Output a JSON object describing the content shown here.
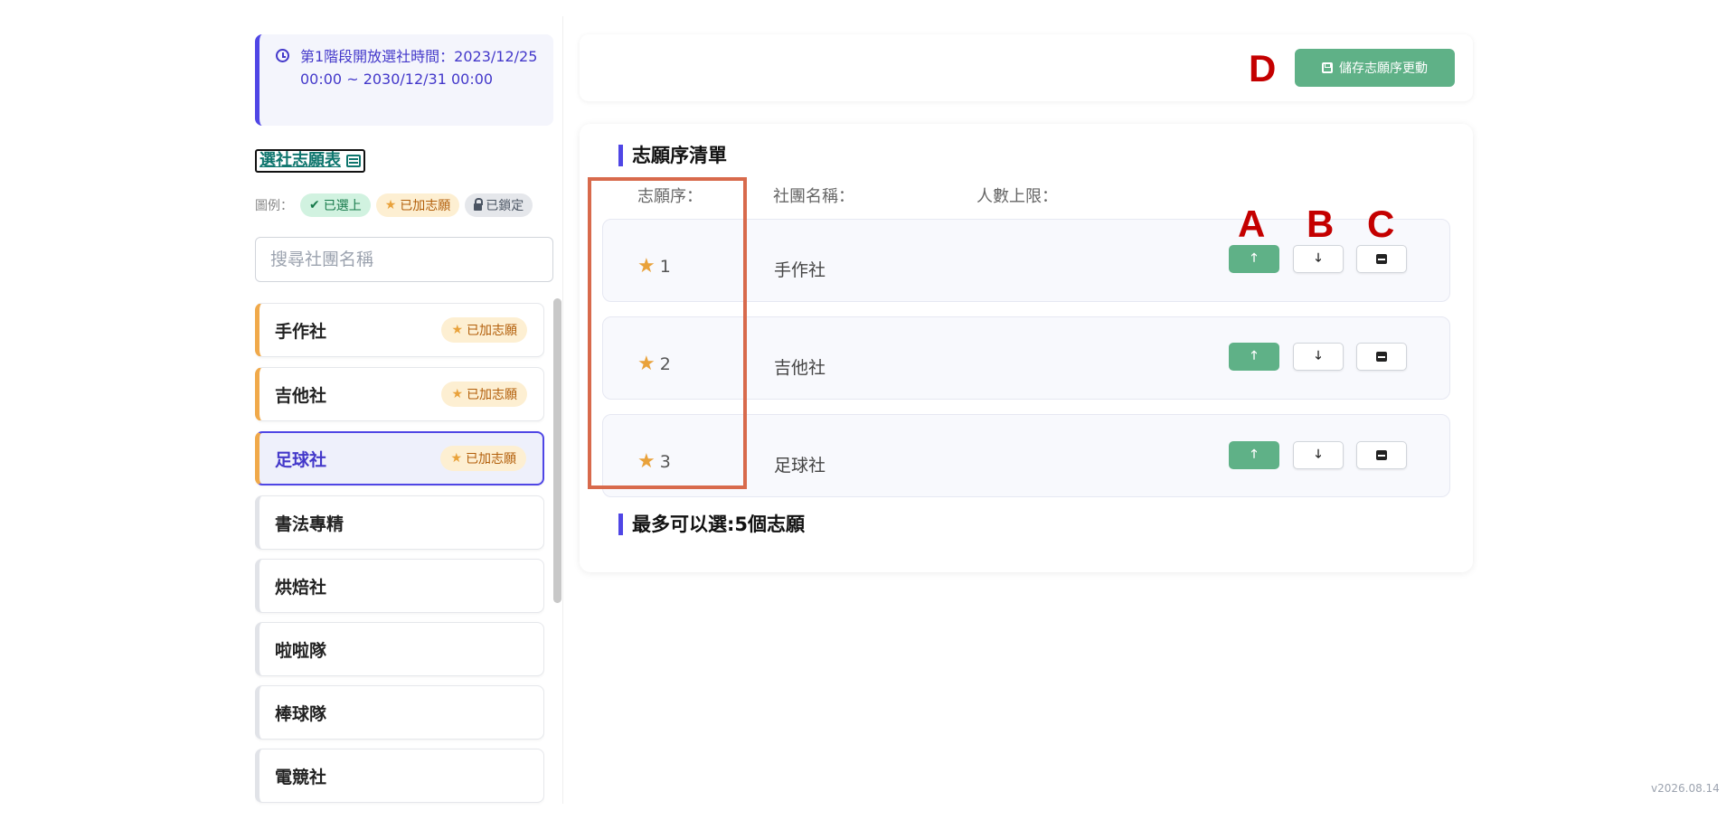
{
  "sidebar": {
    "notice_text": "第1階段開放選社時間：2023/12/25 00:00 ~ 2030/12/31 00:00",
    "table_link": "選社志願表",
    "legend": {
      "label": "圖例：",
      "selected": "已選上",
      "wished": "已加志願",
      "locked": "已鎖定"
    },
    "search_placeholder": "搜尋社團名稱",
    "clubs": [
      {
        "name": "手作社",
        "badge": "已加志願"
      },
      {
        "name": "吉他社",
        "badge": "已加志願"
      },
      {
        "name": "足球社",
        "badge": "已加志願"
      },
      {
        "name": "書法專精"
      },
      {
        "name": "烘焙社"
      },
      {
        "name": "啦啦隊"
      },
      {
        "name": "棒球隊"
      },
      {
        "name": "電競社"
      }
    ]
  },
  "toolbar": {
    "save_label": "儲存志願序更動"
  },
  "main": {
    "list_title": "志願序清單",
    "columns": {
      "rank": "志願序：",
      "name": "社團名稱：",
      "limit": "人數上限："
    },
    "wishes": [
      {
        "rank": "1",
        "name": "手作社"
      },
      {
        "rank": "2",
        "name": "吉他社"
      },
      {
        "rank": "3",
        "name": "足球社"
      }
    ],
    "max_note": "最多可以選:5個志願"
  },
  "annotations": {
    "a": "A",
    "b": "B",
    "c": "C",
    "d": "D"
  },
  "colors": {
    "accent": "#4f46e5",
    "success": "#5fb187",
    "wish": "#f0a94a",
    "annotation": "#c40000",
    "highlight_box": "#d86a4c"
  },
  "version": "v2026.08.14"
}
